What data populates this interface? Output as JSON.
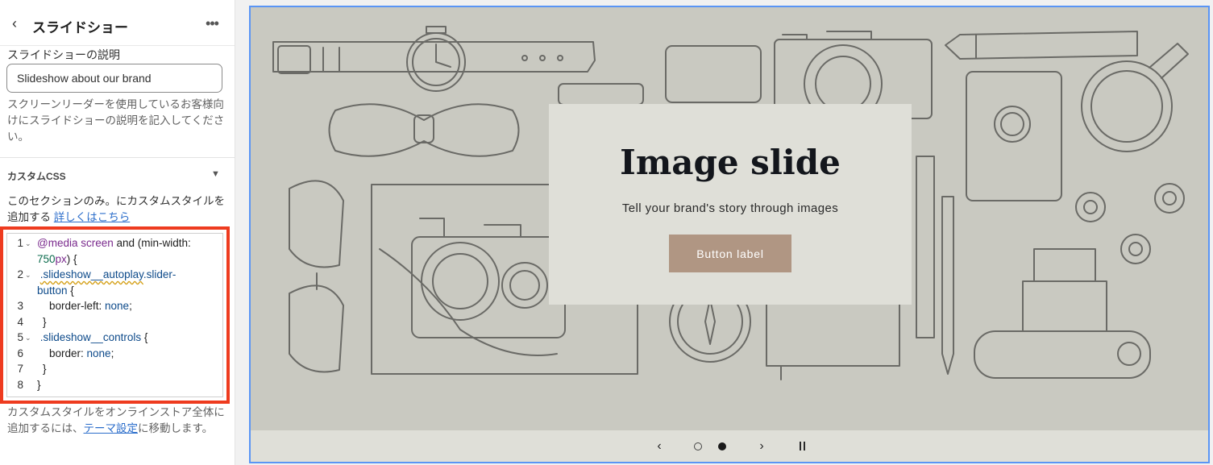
{
  "sidebar": {
    "title": "スライドショー",
    "back_icon": "chevron-left-icon",
    "more_icon": "ellipsis-icon",
    "description_label": "スライドショーの説明",
    "description_value": "Slideshow about our brand",
    "description_help": "スクリーンリーダーを使用しているお客様向けにスライドショーの説明を記入してください。",
    "custom_css": {
      "title": "カスタムCSS",
      "desc_prefix": "このセクションのみ。にカスタムスタイルを追加する",
      "desc_link": "詳しくはこちら",
      "code_lines": [
        {
          "n": "1",
          "fold": true,
          "text": "@media screen and (min-width: 750px) {"
        },
        {
          "n": "2",
          "fold": true,
          "text": ".slideshow__autoplay.slider-button {"
        },
        {
          "n": "3",
          "fold": false,
          "text": "border-left: none;"
        },
        {
          "n": "4",
          "fold": false,
          "text": "}"
        },
        {
          "n": "5",
          "fold": true,
          "text": ".slideshow__controls {"
        },
        {
          "n": "6",
          "fold": false,
          "text": "border: none;"
        },
        {
          "n": "7",
          "fold": false,
          "text": "}"
        },
        {
          "n": "8",
          "fold": false,
          "text": "}"
        }
      ],
      "footer_prefix": "カスタムスタイルをオンラインストア全体に追加するには、",
      "footer_link": "テーマ設定",
      "footer_suffix": "に移動します。"
    }
  },
  "preview": {
    "heading": "Image slide",
    "subheading": "Tell your brand's story through images",
    "button_label": "Button label",
    "controls": {
      "prev_icon": "chevron-left-icon",
      "next_icon": "chevron-right-icon",
      "pause_icon": "pause-icon",
      "slide_count": 2,
      "active_slide": 2
    }
  },
  "colors": {
    "highlight": "#ee3b1f",
    "preview_border": "#5a95f5",
    "button": "#b09683",
    "slide_bg": "#c9c9c1"
  }
}
